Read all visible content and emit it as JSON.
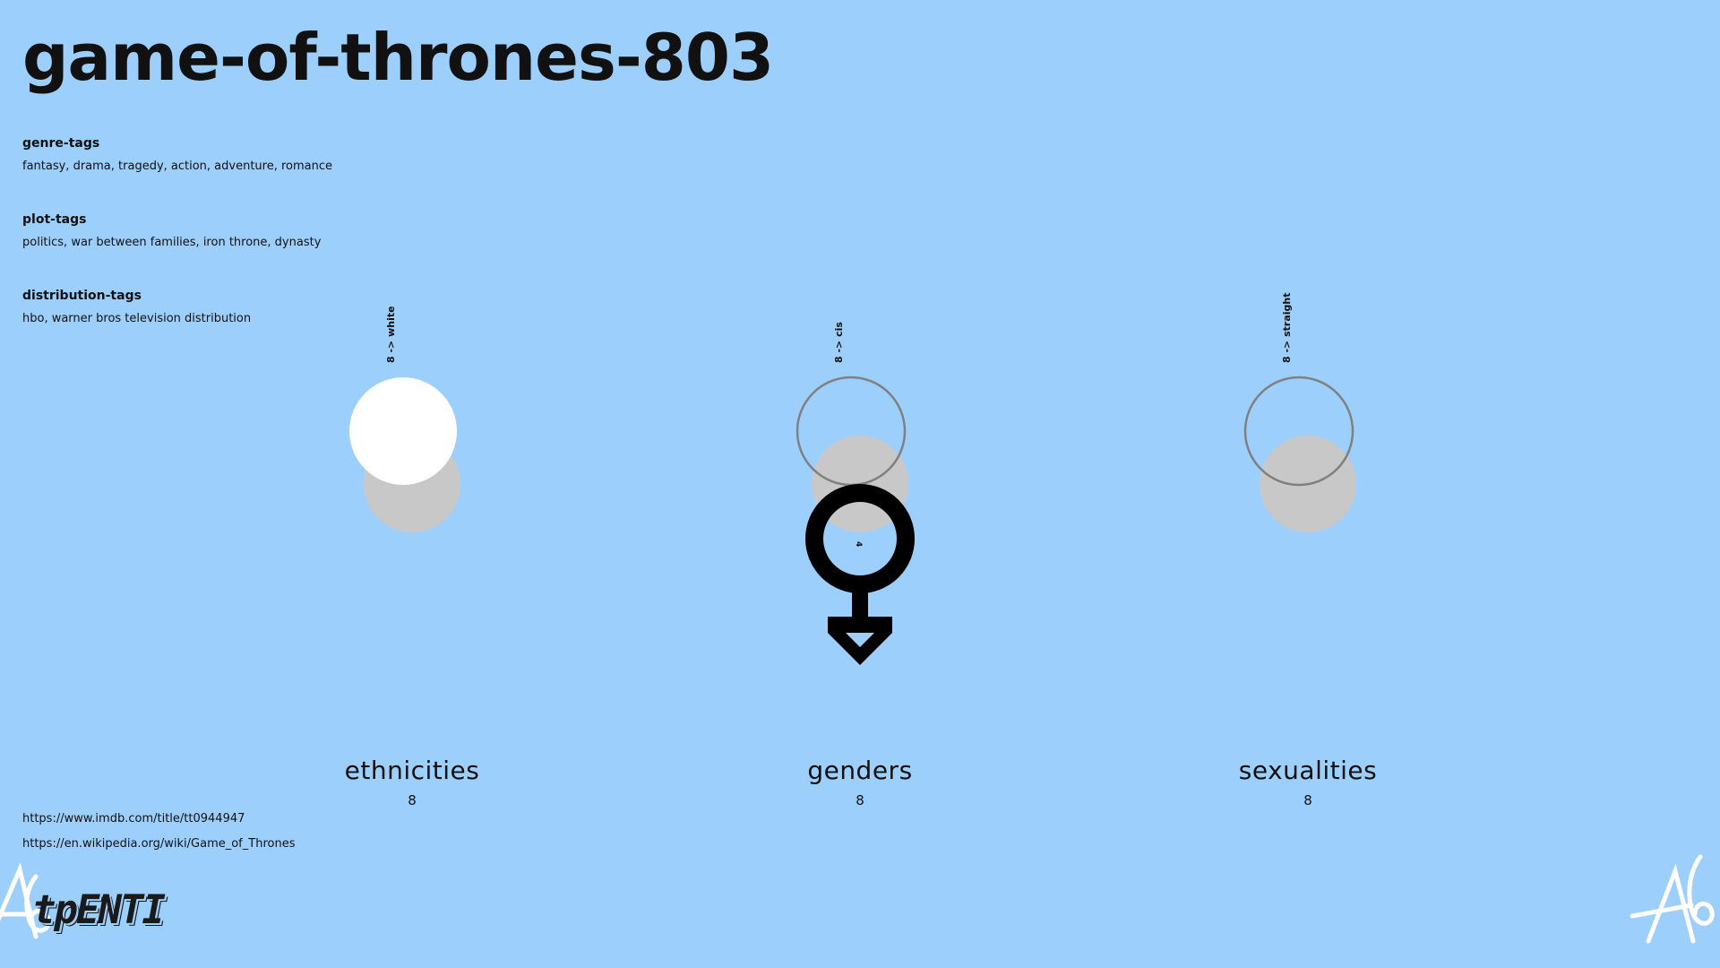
{
  "title": "game-of-thrones-803",
  "genre": {
    "heading": "genre-tags",
    "text": "fantasy, drama, tragedy, action, adventure, romance"
  },
  "plot": {
    "heading": "plot-tags",
    "text": "politics, war between families, iron throne, dynasty"
  },
  "distribution": {
    "heading": "distribution-tags",
    "text": "hbo, warner bros television distribution"
  },
  "columns": [
    {
      "label": "ethnicities",
      "count": "8",
      "annotation": "8 -> white"
    },
    {
      "label": "genders",
      "count": "8",
      "annotation": "8 -> cis",
      "inner_count": "4"
    },
    {
      "label": "sexualities",
      "count": "8",
      "annotation": "8 -> straight"
    }
  ],
  "links": [
    "https://www.imdb.com/title/tt0944947",
    "https://en.wikipedia.org/wiki/Game_of_Thrones"
  ],
  "logo": {
    "text": "tpENTI"
  },
  "colors": {
    "background": "#9dcffd",
    "circle_gray": "#c8c8c8",
    "outline": "#808080",
    "white": "#ffffff",
    "symbol": "#000000"
  },
  "icons": [
    "male-symbol-icon",
    "a6-logo-icon"
  ]
}
